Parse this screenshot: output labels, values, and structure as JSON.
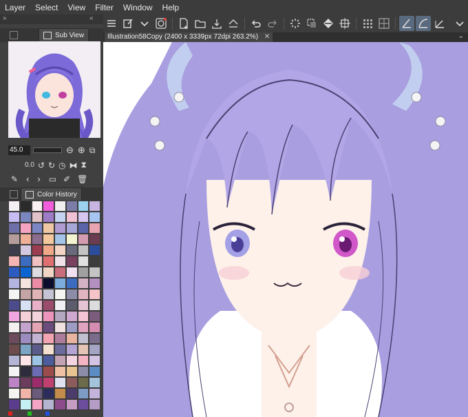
{
  "menu": [
    "Layer",
    "Select",
    "View",
    "Filter",
    "Window",
    "Help"
  ],
  "subview": {
    "tab_label": "Sub View",
    "zoom_value": "45.0",
    "rotation_value": "0.0"
  },
  "color_history": {
    "tab_label": "Color History",
    "swatches": [
      "#f4f0f4",
      "#2b2b2b",
      "#fdf2f3",
      "#f05edc",
      "#f0f0f0",
      "#7c7ca8",
      "#9ad2f0",
      "#c8b4e0",
      "#c8bcf4",
      "#7a86be",
      "#e0c2c8",
      "#9c7cc4",
      "#c4d4f0",
      "#f0c0d4",
      "#d6c6f0",
      "#a8c4f0",
      "#6e6ea8",
      "#f4a4c0",
      "#7c86c4",
      "#f0c8a4",
      "#b09cd0",
      "#a8a8d8",
      "#5a64a8",
      "#e8a4b0",
      "#b49c9c",
      "#f0b098",
      "#8c6c8c",
      "#f4c89c",
      "#a4c4e8",
      "#f4f4d0",
      "#d49cb0",
      "#6c3c50",
      "#3c3c4c",
      "#d4c8e0",
      "#9c3c50",
      "#f0a888",
      "#f4d4c4",
      "#6a6a7c",
      "#c4c4c4",
      "#2c4c9c",
      "#f4b4b4",
      "#3c6cc0",
      "#f0c0c0",
      "#e07070",
      "#f0e0e8",
      "#7a4060",
      "#e0e0e0",
      "#3c3c3c",
      "#2c5cc0",
      "#0c64d0",
      "#dcdce0",
      "#f0d4c4",
      "#c86c7c",
      "#f0e0f0",
      "#a0a0a0",
      "#c4c4c4",
      "#b4b4e0",
      "#f4e4e0",
      "#ec8ca4",
      "#0c0c2c",
      "#7cacdc",
      "#3c6cc0",
      "#d4b4c4",
      "#b490c0",
      "#f4f4f4",
      "#c4a4a4",
      "#e0b4b4",
      "#c4c4d4",
      "#f4f4f0",
      "#8c8ca8",
      "#e0b4c0",
      "#f4c4c8",
      "#4c4c8c",
      "#d8e0f4",
      "#e8b0c8",
      "#9c4c6c",
      "#f0f0f4",
      "#5c5c6c",
      "#e4c4d4",
      "#dcdcdc",
      "#f0a4e0",
      "#f4d0d8",
      "#f4d4dc",
      "#ec94bc",
      "#b4a8c0",
      "#cfa8d0",
      "#f4c4d4",
      "#7c5c7c",
      "#f4f0f0",
      "#c4a4cc",
      "#e4a4b4",
      "#6c4c7c",
      "#f0e0e0",
      "#9c9cc4",
      "#e0a4c0",
      "#d48cb0",
      "#6c4c5c",
      "#9c8cc0",
      "#c4b4d4",
      "#f4a4b0",
      "#ac7c9c",
      "#e8b4a0",
      "#c0c0d0",
      "#7c6c8c",
      "#6c4c4c",
      "#7ca4c4",
      "#5c5c8c",
      "#f4e0d0",
      "#6c6c9c",
      "#b4a4d4",
      "#e4c4b4",
      "#a4a4c4",
      "#b4b4d4",
      "#fce4e8",
      "#9cc4e4",
      "#4c5c9c",
      "#c4a4b4",
      "#f4d4e0",
      "#f4b4c4",
      "#d4c4e4",
      "#f4f4f4",
      "#2c2c3c",
      "#6c6cb4",
      "#9c4c4c",
      "#f0c0a4",
      "#e8c490",
      "#8c8ca8",
      "#5c8cc4",
      "#bc84c4",
      "#6c3c5c",
      "#9c2c6c",
      "#c04070",
      "#e0e0f0",
      "#8c5c5c",
      "#6c6c4c",
      "#a4c4dc",
      "#f4f4f0",
      "#f0b4a8",
      "#6c5c7c",
      "#2c2c5c",
      "#c48c4c",
      "#4c3c6c",
      "#7c9cc4",
      "#c4b4dc",
      "#5c3c8c",
      "#c4f0f4",
      "#f4a4c4",
      "#b4b4d0",
      "#8c4c8c",
      "#c49cc4",
      "#6c4c9c",
      "#b49cc4"
    ]
  },
  "document": {
    "tab_label": "Illustration58Copy (2400 x 3339px 72dpi 263.2%)"
  }
}
